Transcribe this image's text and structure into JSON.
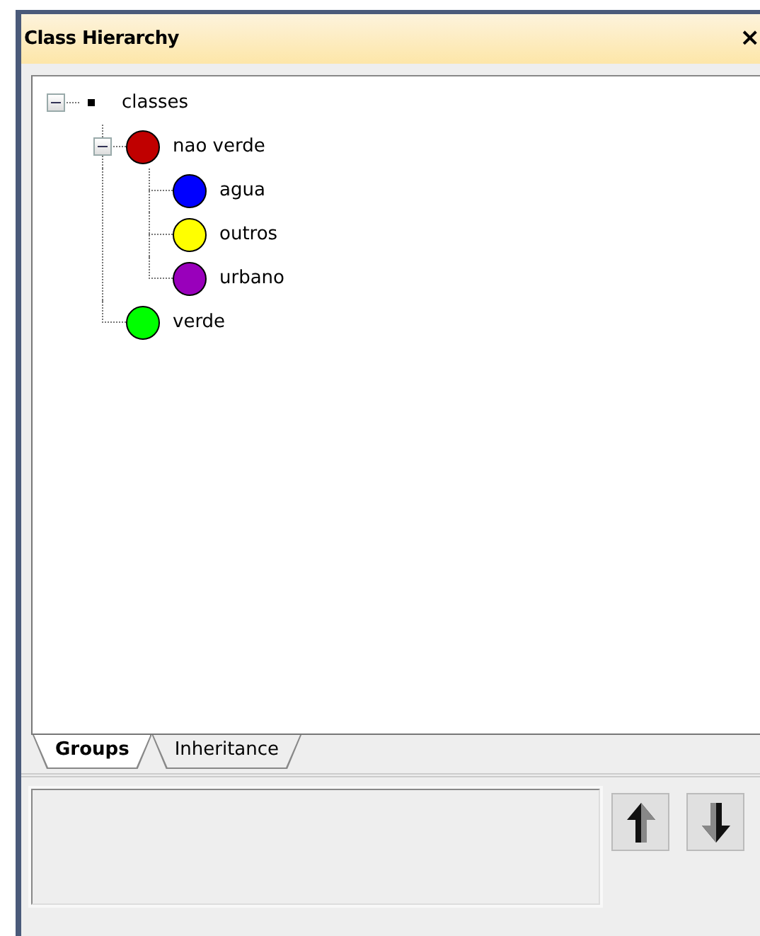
{
  "window": {
    "title": "Class Hierarchy",
    "close": "×"
  },
  "tree": [
    {
      "label": "classes",
      "kind": "root",
      "expanded": true,
      "children": [
        {
          "label": "nao verde",
          "kind": "class",
          "color": "#c00000",
          "expanded": true,
          "children": [
            {
              "label": "agua",
              "kind": "class",
              "color": "#0000ff"
            },
            {
              "label": "outros",
              "kind": "class",
              "color": "#ffff00"
            },
            {
              "label": "urbano",
              "kind": "class",
              "color": "#9900bb"
            }
          ]
        },
        {
          "label": "verde",
          "kind": "class",
          "color": "#00ff00"
        }
      ]
    }
  ],
  "tabs": [
    {
      "label": "Groups",
      "selected": true
    },
    {
      "label": "Inheritance",
      "selected": false
    }
  ],
  "buttons": [
    {
      "kind": "up"
    },
    {
      "kind": "down"
    }
  ]
}
